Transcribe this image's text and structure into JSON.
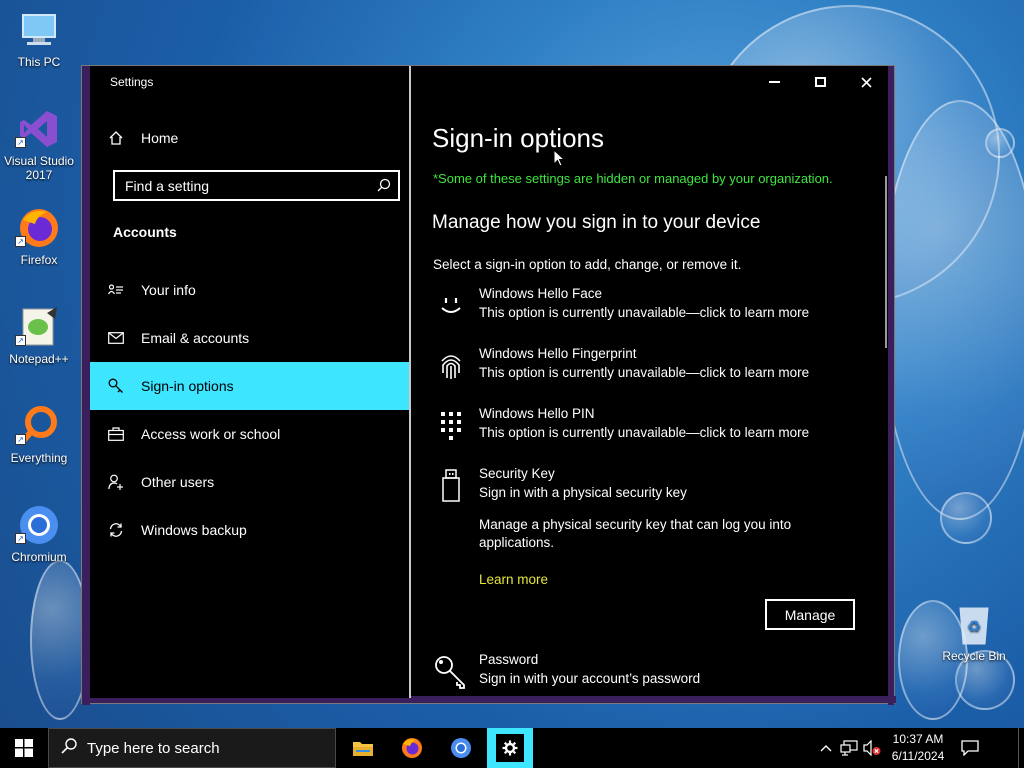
{
  "desktop": {
    "icons": [
      {
        "label": "This PC"
      },
      {
        "label": "Visual Studio 2017"
      },
      {
        "label": "Firefox"
      },
      {
        "label": "Notepad++"
      },
      {
        "label": "Everything"
      },
      {
        "label": "Chromium"
      },
      {
        "label": "Recycle Bin"
      }
    ]
  },
  "window": {
    "title": "Settings",
    "home_label": "Home",
    "search_placeholder": "Find a setting",
    "section_label": "Accounts",
    "nav": [
      {
        "label": "Your info",
        "icon": "person-card-icon"
      },
      {
        "label": "Email & accounts",
        "icon": "mail-icon"
      },
      {
        "label": "Sign-in options",
        "icon": "key-icon",
        "active": true
      },
      {
        "label": "Access work or school",
        "icon": "briefcase-icon"
      },
      {
        "label": "Other users",
        "icon": "add-user-icon"
      },
      {
        "label": "Windows backup",
        "icon": "sync-icon"
      }
    ]
  },
  "main": {
    "title": "Sign-in options",
    "notice": "*Some of these settings are hidden or managed by your organization.",
    "subheading": "Manage how you sign in to your device",
    "description": "Select a sign-in option to add, change, or remove it.",
    "options": [
      {
        "title": "Windows Hello Face",
        "subtitle": "This option is currently unavailable—click to learn more",
        "icon": "face-icon"
      },
      {
        "title": "Windows Hello Fingerprint",
        "subtitle": "This option is currently unavailable—click to learn more",
        "icon": "fingerprint-icon"
      },
      {
        "title": "Windows Hello PIN",
        "subtitle": "This option is currently unavailable—click to learn more",
        "icon": "pin-keypad-icon"
      },
      {
        "title": "Security Key",
        "subtitle": "Sign in with a physical security key",
        "icon": "usb-key-icon"
      },
      {
        "title": "Password",
        "subtitle": "Sign in with your account’s password",
        "icon": "password-key-icon"
      }
    ],
    "security_key_detail": "Manage a physical security key that can log you into applications.",
    "learn_more": "Learn more",
    "manage_button": "Manage"
  },
  "taskbar": {
    "search_placeholder": "Type here to search",
    "time": "10:37 AM",
    "date": "6/11/2024"
  },
  "colors": {
    "accent": "#3ee5ff",
    "notice_green": "#3ee53e",
    "link_yellow": "#e5e53e",
    "window_frame": "#3a1f5c"
  }
}
